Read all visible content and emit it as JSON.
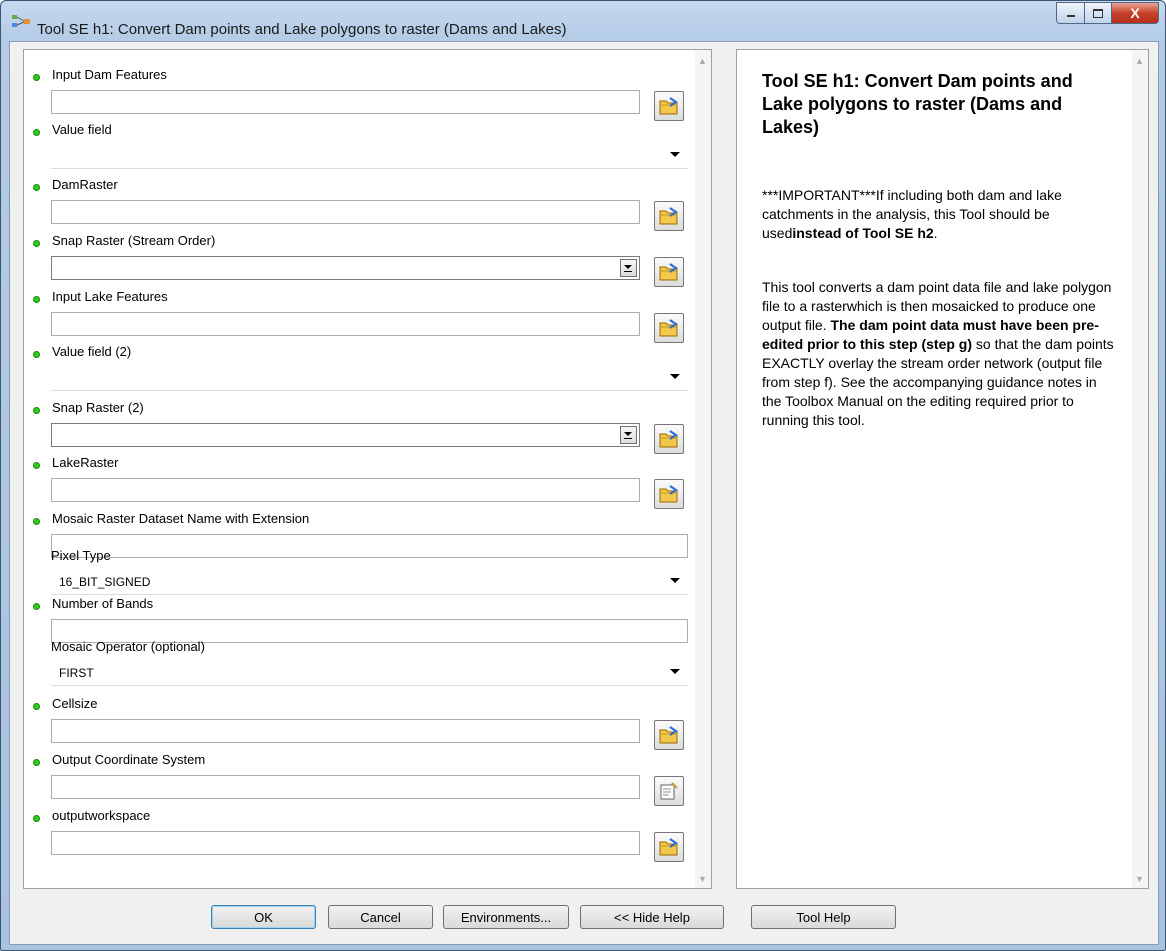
{
  "window": {
    "title": "Tool SE h1: Convert Dam points and Lake polygons to raster (Dams and Lakes)",
    "close_label": "X"
  },
  "params": [
    {
      "label": "Input Dam Features",
      "value": "",
      "required": true,
      "kind": "browse"
    },
    {
      "label": "Value field",
      "value": "",
      "required": true,
      "kind": "dropdown"
    },
    {
      "label": "DamRaster",
      "value": "",
      "required": true,
      "kind": "browse"
    },
    {
      "label": "Snap Raster (Stream Order)",
      "value": "",
      "required": true,
      "kind": "combo-browse"
    },
    {
      "label": "Input Lake Features",
      "value": "",
      "required": true,
      "kind": "browse"
    },
    {
      "label": "Value field (2)",
      "value": "",
      "required": true,
      "kind": "dropdown"
    },
    {
      "label": "Snap Raster (2)",
      "value": "",
      "required": true,
      "kind": "combo-browse"
    },
    {
      "label": "LakeRaster",
      "value": "",
      "required": true,
      "kind": "browse"
    },
    {
      "label": "Mosaic Raster Dataset Name with Extension",
      "value": "",
      "required": true,
      "kind": "text"
    },
    {
      "label": "Pixel Type",
      "value": "16_BIT_SIGNED",
      "required": false,
      "kind": "dropdown"
    },
    {
      "label": "Number of Bands",
      "value": "",
      "required": true,
      "kind": "text"
    },
    {
      "label": "Mosaic Operator (optional)",
      "value": "FIRST",
      "required": false,
      "kind": "dropdown"
    },
    {
      "label": "Cellsize",
      "value": "",
      "required": true,
      "kind": "browse"
    },
    {
      "label": "Output Coordinate System",
      "value": "",
      "required": true,
      "kind": "properties"
    },
    {
      "label": "outputworkspace",
      "value": "",
      "required": true,
      "kind": "browse"
    }
  ],
  "help": {
    "title": "Tool SE h1: Convert Dam points and Lake polygons to raster (Dams and Lakes)",
    "p1_a": "***IMPORTANT***If including both dam and lake catchments in the analysis, this Tool should be used",
    "p1_b": "instead of Tool SE h2",
    "p1_c": ".",
    "p2_a": "This tool converts a dam point data file and lake polygon file to a rasterwhich is then mosaicked to produce one output file. ",
    "p2_b": "The dam point data must have been pre-edited prior to this step (step g)",
    "p2_c": " so that the dam points EXACTLY overlay the stream order network (output file from step f). See the accompanying guidance notes in the Toolbox Manual on the editing required prior to running this tool."
  },
  "buttons": {
    "ok": "OK",
    "cancel": "Cancel",
    "environments": "Environments...",
    "hide_help": "<< Hide Help",
    "tool_help": "Tool Help"
  }
}
